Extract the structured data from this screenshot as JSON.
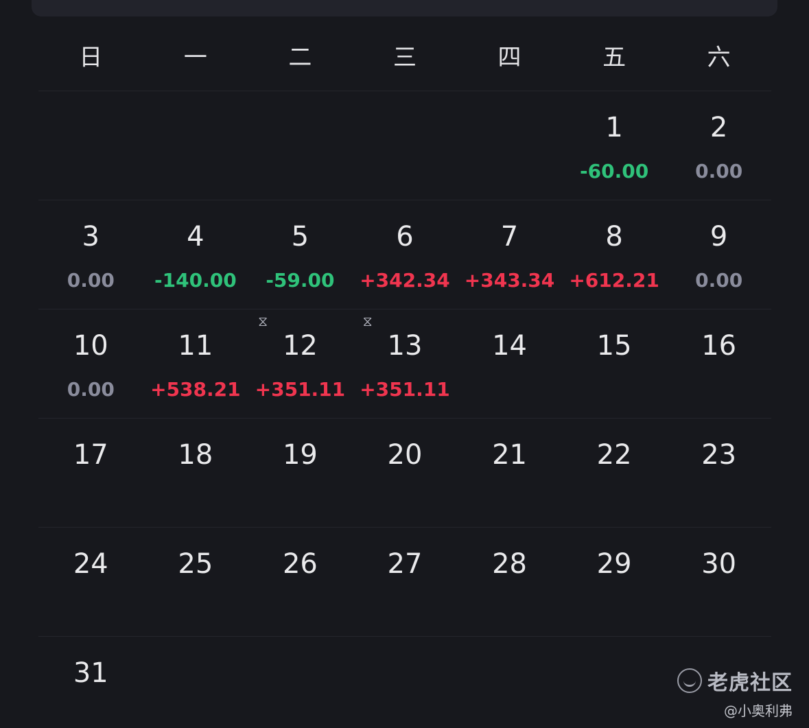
{
  "weekdays": [
    "日",
    "一",
    "二",
    "三",
    "四",
    "五",
    "六"
  ],
  "weeks": [
    [
      {
        "day": "",
        "pnl": "",
        "tone": ""
      },
      {
        "day": "",
        "pnl": "",
        "tone": ""
      },
      {
        "day": "",
        "pnl": "",
        "tone": ""
      },
      {
        "day": "",
        "pnl": "",
        "tone": ""
      },
      {
        "day": "",
        "pnl": "",
        "tone": ""
      },
      {
        "day": "1",
        "pnl": "-60.00",
        "tone": "neg"
      },
      {
        "day": "2",
        "pnl": "0.00",
        "tone": "zero"
      }
    ],
    [
      {
        "day": "3",
        "pnl": "0.00",
        "tone": "zero"
      },
      {
        "day": "4",
        "pnl": "-140.00",
        "tone": "neg"
      },
      {
        "day": "5",
        "pnl": "-59.00",
        "tone": "neg"
      },
      {
        "day": "6",
        "pnl": "+342.34",
        "tone": "pos"
      },
      {
        "day": "7",
        "pnl": "+343.34",
        "tone": "pos"
      },
      {
        "day": "8",
        "pnl": "+612.21",
        "tone": "pos"
      },
      {
        "day": "9",
        "pnl": "0.00",
        "tone": "zero"
      }
    ],
    [
      {
        "day": "10",
        "pnl": "0.00",
        "tone": "zero"
      },
      {
        "day": "11",
        "pnl": "+538.21",
        "tone": "pos"
      },
      {
        "day": "12",
        "pnl": "+351.11",
        "tone": "pos",
        "pending": true
      },
      {
        "day": "13",
        "pnl": "+351.11",
        "tone": "pos",
        "pending": true
      },
      {
        "day": "14",
        "pnl": "",
        "tone": ""
      },
      {
        "day": "15",
        "pnl": "",
        "tone": ""
      },
      {
        "day": "16",
        "pnl": "",
        "tone": ""
      }
    ],
    [
      {
        "day": "17",
        "pnl": "",
        "tone": ""
      },
      {
        "day": "18",
        "pnl": "",
        "tone": ""
      },
      {
        "day": "19",
        "pnl": "",
        "tone": ""
      },
      {
        "day": "20",
        "pnl": "",
        "tone": ""
      },
      {
        "day": "21",
        "pnl": "",
        "tone": ""
      },
      {
        "day": "22",
        "pnl": "",
        "tone": ""
      },
      {
        "day": "23",
        "pnl": "",
        "tone": ""
      }
    ],
    [
      {
        "day": "24",
        "pnl": "",
        "tone": ""
      },
      {
        "day": "25",
        "pnl": "",
        "tone": ""
      },
      {
        "day": "26",
        "pnl": "",
        "tone": ""
      },
      {
        "day": "27",
        "pnl": "",
        "tone": ""
      },
      {
        "day": "28",
        "pnl": "",
        "tone": ""
      },
      {
        "day": "29",
        "pnl": "",
        "tone": ""
      },
      {
        "day": "30",
        "pnl": "",
        "tone": ""
      }
    ],
    [
      {
        "day": "31",
        "pnl": "",
        "tone": ""
      },
      {
        "day": "",
        "pnl": "",
        "tone": ""
      },
      {
        "day": "",
        "pnl": "",
        "tone": ""
      },
      {
        "day": "",
        "pnl": "",
        "tone": ""
      },
      {
        "day": "",
        "pnl": "",
        "tone": ""
      },
      {
        "day": "",
        "pnl": "",
        "tone": ""
      },
      {
        "day": "",
        "pnl": "",
        "tone": ""
      }
    ]
  ],
  "icons": {
    "pending": "hourglass-icon",
    "logo": "tiger-logo-icon"
  },
  "colors": {
    "positive": "#f0354f",
    "negative": "#2fc27a",
    "zero": "#8a8c9c",
    "background": "#17181d"
  },
  "watermark": {
    "brand": "老虎社区",
    "user": "@小奥利弗"
  }
}
